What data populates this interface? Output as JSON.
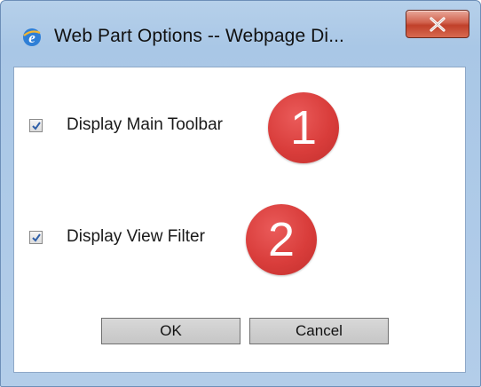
{
  "window": {
    "title": "Web Part Options -- Webpage Di...",
    "icon": "internet-explorer-icon",
    "close_icon": "close-x-icon"
  },
  "options": [
    {
      "label": "Display Main Toolbar",
      "checked": true,
      "badge": "1"
    },
    {
      "label": "Display View Filter",
      "checked": true,
      "badge": "2"
    }
  ],
  "buttons": {
    "ok_label": "OK",
    "cancel_label": "Cancel"
  },
  "colors": {
    "badge": "#d93d3b",
    "frame": "#b3cde9",
    "close_button": "#c0402a"
  }
}
